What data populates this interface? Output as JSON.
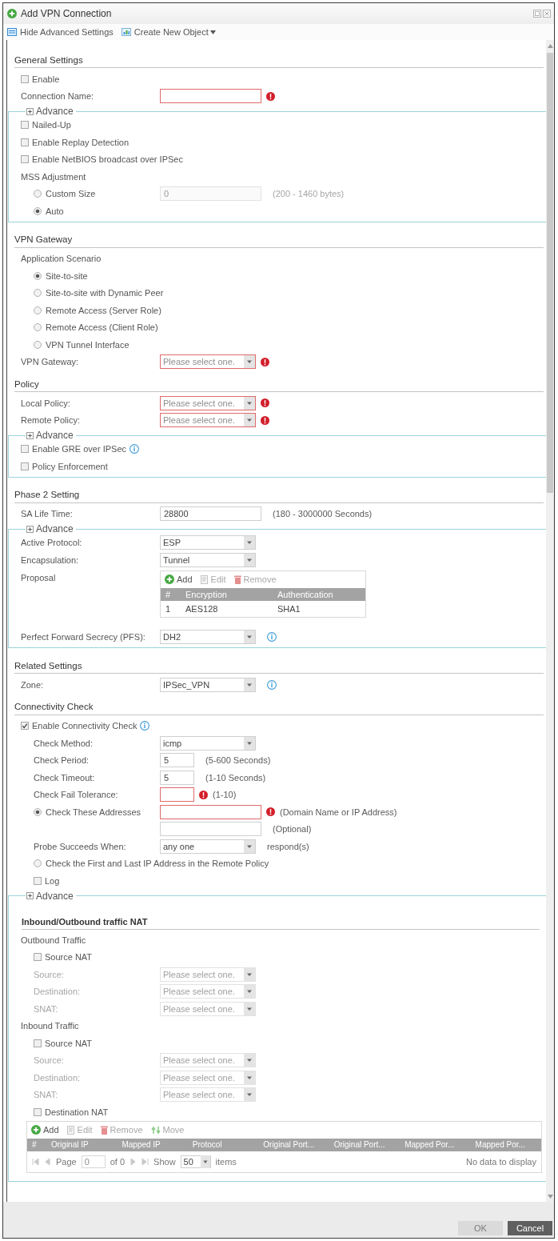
{
  "window": {
    "title": "Add VPN Connection"
  },
  "toolbar": [
    {
      "kind": "hide_advanced",
      "label": "Hide Advanced Settings",
      "menu": false
    },
    {
      "kind": "create_object",
      "label": "Create New Object",
      "menu": true
    }
  ],
  "sections": [
    {
      "title": "General Settings",
      "rows": [
        {
          "kind": "checkbox",
          "label": "Enable",
          "checked": false
        },
        {
          "kind": "text_field",
          "label": "Connection Name:",
          "error": true
        },
        {
          "kind": "advance",
          "label": "Advance",
          "expanded": true,
          "rows": [
            {
              "kind": "checkbox",
              "label": "Nailed-Up",
              "checked": false
            },
            {
              "kind": "checkbox",
              "label": "Enable Replay Detection",
              "checked": false
            },
            {
              "kind": "checkbox",
              "label": "Enable NetBIOS broadcast over IPSec",
              "checked": false
            },
            {
              "kind": "caption",
              "label": "MSS Adjustment",
              "children": [
                {
                  "kind": "radio_field",
                  "label": "Custom Size",
                  "selected": false,
                  "value": "0",
                  "disabled": true,
                  "hint": "(200 - 1460 bytes)"
                },
                {
                  "kind": "radio",
                  "label": "Auto",
                  "selected": true
                }
              ]
            }
          ]
        }
      ]
    },
    {
      "title": "VPN Gateway",
      "rows": [
        {
          "kind": "caption",
          "label": "Application Scenario",
          "children": [
            {
              "kind": "radio",
              "label": "Site-to-site",
              "selected": true
            },
            {
              "kind": "radio",
              "label": "Site-to-site with Dynamic Peer",
              "selected": false
            },
            {
              "kind": "radio",
              "label": "Remote Access (Server Role)",
              "selected": false
            },
            {
              "kind": "radio",
              "label": "Remote Access (Client Role)",
              "selected": false
            },
            {
              "kind": "radio",
              "label": "VPN Tunnel Interface",
              "selected": false
            }
          ]
        },
        {
          "kind": "select",
          "label": "VPN Gateway:",
          "placeholder": "Please select one.",
          "error": true
        }
      ]
    },
    {
      "title": "Policy",
      "rows": [
        {
          "kind": "select",
          "label": "Local Policy:",
          "placeholder": "Please select one.",
          "error": true
        },
        {
          "kind": "select",
          "label": "Remote Policy:",
          "placeholder": "Please select one.",
          "error": true
        },
        {
          "kind": "advance",
          "label": "Advance",
          "expanded": true,
          "rows": [
            {
              "kind": "checkbox",
              "label": "Enable GRE over IPSec",
              "checked": false,
              "info": true
            },
            {
              "kind": "checkbox",
              "label": "Policy Enforcement",
              "checked": false
            }
          ]
        }
      ]
    },
    {
      "title": "Phase 2 Setting",
      "rows": [
        {
          "kind": "text_field",
          "label": "SA Life Time:",
          "value": "28800",
          "hint": "(180 - 3000000 Seconds)"
        },
        {
          "kind": "advance",
          "label": "Advance",
          "expanded": true,
          "rows": [
            {
              "kind": "select",
              "label": "Active Protocol:",
              "value": "ESP"
            },
            {
              "kind": "select",
              "label": "Encapsulation:",
              "value": "Tunnel"
            },
            {
              "kind": "table",
              "label": "Proposal",
              "actions": [
                {
                  "kind": "add",
                  "label": "Add",
                  "disabled": false
                },
                {
                  "kind": "edit",
                  "label": "Edit",
                  "disabled": true
                },
                {
                  "kind": "remove",
                  "label": "Remove",
                  "disabled": true
                }
              ],
              "columns": [
                "#",
                "Encryption",
                "Authentication"
              ],
              "rows": [
                [
                  "1",
                  "AES128",
                  "SHA1"
                ]
              ]
            },
            {
              "kind": "select",
              "label": "Perfect Forward Secrecy (PFS):",
              "value": "DH2",
              "info": true
            }
          ]
        }
      ]
    },
    {
      "title": "Related Settings",
      "rows": [
        {
          "kind": "select",
          "label": "Zone:",
          "value": "IPSec_VPN",
          "info": true
        }
      ]
    },
    {
      "title": "Connectivity Check",
      "rows": [
        {
          "kind": "checkbox",
          "label": "Enable Connectivity Check",
          "checked": true,
          "info": true,
          "children": [
            {
              "kind": "select",
              "label": "Check Method:",
              "value": "icmp"
            },
            {
              "kind": "number_field",
              "label": "Check Period:",
              "value": "5",
              "hint": "(5-600 Seconds)"
            },
            {
              "kind": "number_field",
              "label": "Check Timeout:",
              "value": "5",
              "hint": "(1-10 Seconds)"
            },
            {
              "kind": "number_field",
              "label": "Check Fail Tolerance:",
              "error": true,
              "hint": "(1-10)"
            },
            {
              "kind": "radio_field",
              "label": "Check These Addresses",
              "selected": true,
              "error": true,
              "hint": "(Domain Name or IP Address)"
            },
            {
              "kind": "text_field",
              "hint": "(Optional)"
            },
            {
              "kind": "select",
              "label": "Probe Succeeds When:",
              "value": "any one",
              "hint": "respond(s)"
            },
            {
              "kind": "radio",
              "label": "Check the First and Last IP Address in the Remote Policy",
              "selected": false
            },
            {
              "kind": "checkbox",
              "label": "Log",
              "checked": false
            }
          ]
        },
        {
          "kind": "advance",
          "label": "Advance",
          "expanded": true,
          "rows": [
            {
              "kind": "subsection",
              "label": "Inbound/Outbound traffic NAT"
            },
            {
              "kind": "caption",
              "label": "Outbound Traffic",
              "children": [
                {
                  "kind": "checkbox",
                  "label": "Source NAT",
                  "checked": false
                },
                {
                  "kind": "select",
                  "label": "Source:",
                  "placeholder": "Please select one.",
                  "disabled": true
                },
                {
                  "kind": "select",
                  "label": "Destination:",
                  "placeholder": "Please select one.",
                  "disabled": true
                },
                {
                  "kind": "select",
                  "label": "SNAT:",
                  "placeholder": "Please select one.",
                  "disabled": true
                }
              ]
            },
            {
              "kind": "caption",
              "label": "Inbound Traffic",
              "children": [
                {
                  "kind": "checkbox",
                  "label": "Source NAT",
                  "checked": false
                },
                {
                  "kind": "select",
                  "label": "Source:",
                  "placeholder": "Please select one.",
                  "disabled": true
                },
                {
                  "kind": "select",
                  "label": "Destination:",
                  "placeholder": "Please select one.",
                  "disabled": true
                },
                {
                  "kind": "select",
                  "label": "SNAT:",
                  "placeholder": "Please select one.",
                  "disabled": true
                },
                {
                  "kind": "checkbox",
                  "label": "Destination NAT",
                  "checked": false
                }
              ]
            },
            {
              "kind": "table",
              "actions": [
                {
                  "kind": "add",
                  "label": "Add",
                  "disabled": false
                },
                {
                  "kind": "edit",
                  "label": "Edit",
                  "disabled": true
                },
                {
                  "kind": "remove",
                  "label": "Remove",
                  "disabled": true
                },
                {
                  "kind": "move",
                  "label": "Move",
                  "disabled": true
                }
              ],
              "columns": [
                "#",
                "Original IP",
                "Mapped IP",
                "Protocol",
                "Original Port...",
                "Original Port...",
                "Mapped Por...",
                "Mapped Por..."
              ],
              "pager": {
                "page_label": "Page",
                "page": "0",
                "total": "of 0",
                "show_label": "Show",
                "per_page": "50",
                "unit": "items",
                "empty": "No data to display",
                "nav_disabled": true
              }
            }
          ]
        }
      ]
    }
  ],
  "footer": {
    "buttons": [
      {
        "label": "OK",
        "disabled": true
      },
      {
        "label": "Cancel",
        "disabled": false
      }
    ]
  }
}
